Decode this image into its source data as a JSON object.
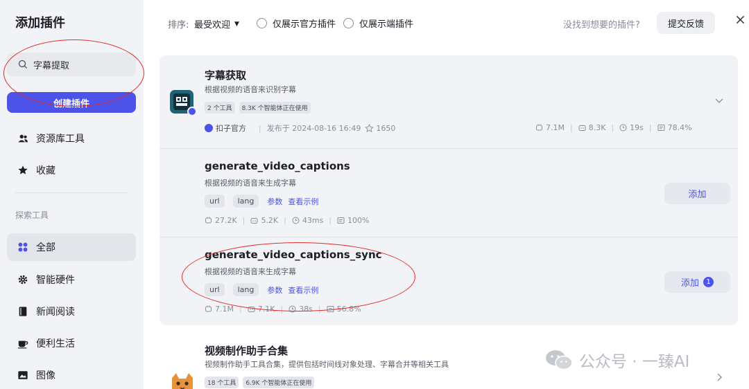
{
  "sidebar": {
    "title": "添加插件",
    "search_value": "字幕提取",
    "create_button": "创建插件",
    "items": [
      {
        "label": "资源库工具",
        "icon": "users-icon"
      },
      {
        "label": "收藏",
        "icon": "star-icon"
      }
    ],
    "section_label": "探索工具",
    "categories": [
      {
        "label": "全部",
        "icon": "grid-icon",
        "active": true
      },
      {
        "label": "智能硬件",
        "icon": "gear-icon"
      },
      {
        "label": "新闻阅读",
        "icon": "book-icon"
      },
      {
        "label": "便利生活",
        "icon": "coffee-icon"
      },
      {
        "label": "图像",
        "icon": "image-icon"
      }
    ]
  },
  "topbar": {
    "sort_label": "排序:",
    "sort_value": "最受欢迎",
    "filter_official": "仅展示官方插件",
    "filter_client": "仅展示端插件",
    "hint": "没找到想要的插件?",
    "feedback_button": "提交反馈"
  },
  "plugin": {
    "title": "字幕获取",
    "description": "根据视频的语音来识别字幕",
    "tags": [
      "2 个工具",
      "8.3K 个智能体正在使用"
    ],
    "publisher": "扣子官方",
    "published": "发布于 2024-08-16 16:49",
    "favorites": "1650",
    "stats": [
      "7.1M",
      "8.3K",
      "19s",
      "78.4%"
    ],
    "tools": [
      {
        "name": "generate_video_captions",
        "description": "根据视频的语音来生成字幕",
        "params": [
          "url",
          "lang"
        ],
        "param_link": "参数",
        "example_link": "查看示例",
        "stats": [
          "27.2K",
          "5.2K",
          "43ms",
          "100%"
        ],
        "add_label": "添加",
        "count": ""
      },
      {
        "name": "generate_video_captions_sync",
        "description": "根据视频的语音来生成字幕",
        "params": [
          "url",
          "lang"
        ],
        "param_link": "参数",
        "example_link": "查看示例",
        "stats": [
          "7.1M",
          "7.1K",
          "38s",
          "56.8%"
        ],
        "add_label": "添加",
        "count": "1"
      }
    ]
  },
  "plugin2": {
    "title": "视频制作助手合集",
    "description": "视频制作助手工具合集，提供包括时间线对象处理、字幕合并等相关工具",
    "tags": [
      "18 个工具",
      "6.9K 个智能体正在使用"
    ]
  },
  "watermark": "公众号 · 一臻AI",
  "colors": {
    "accent": "#4d53e8",
    "annotation": "#e02b2b",
    "panel": "#f2f3f6"
  }
}
